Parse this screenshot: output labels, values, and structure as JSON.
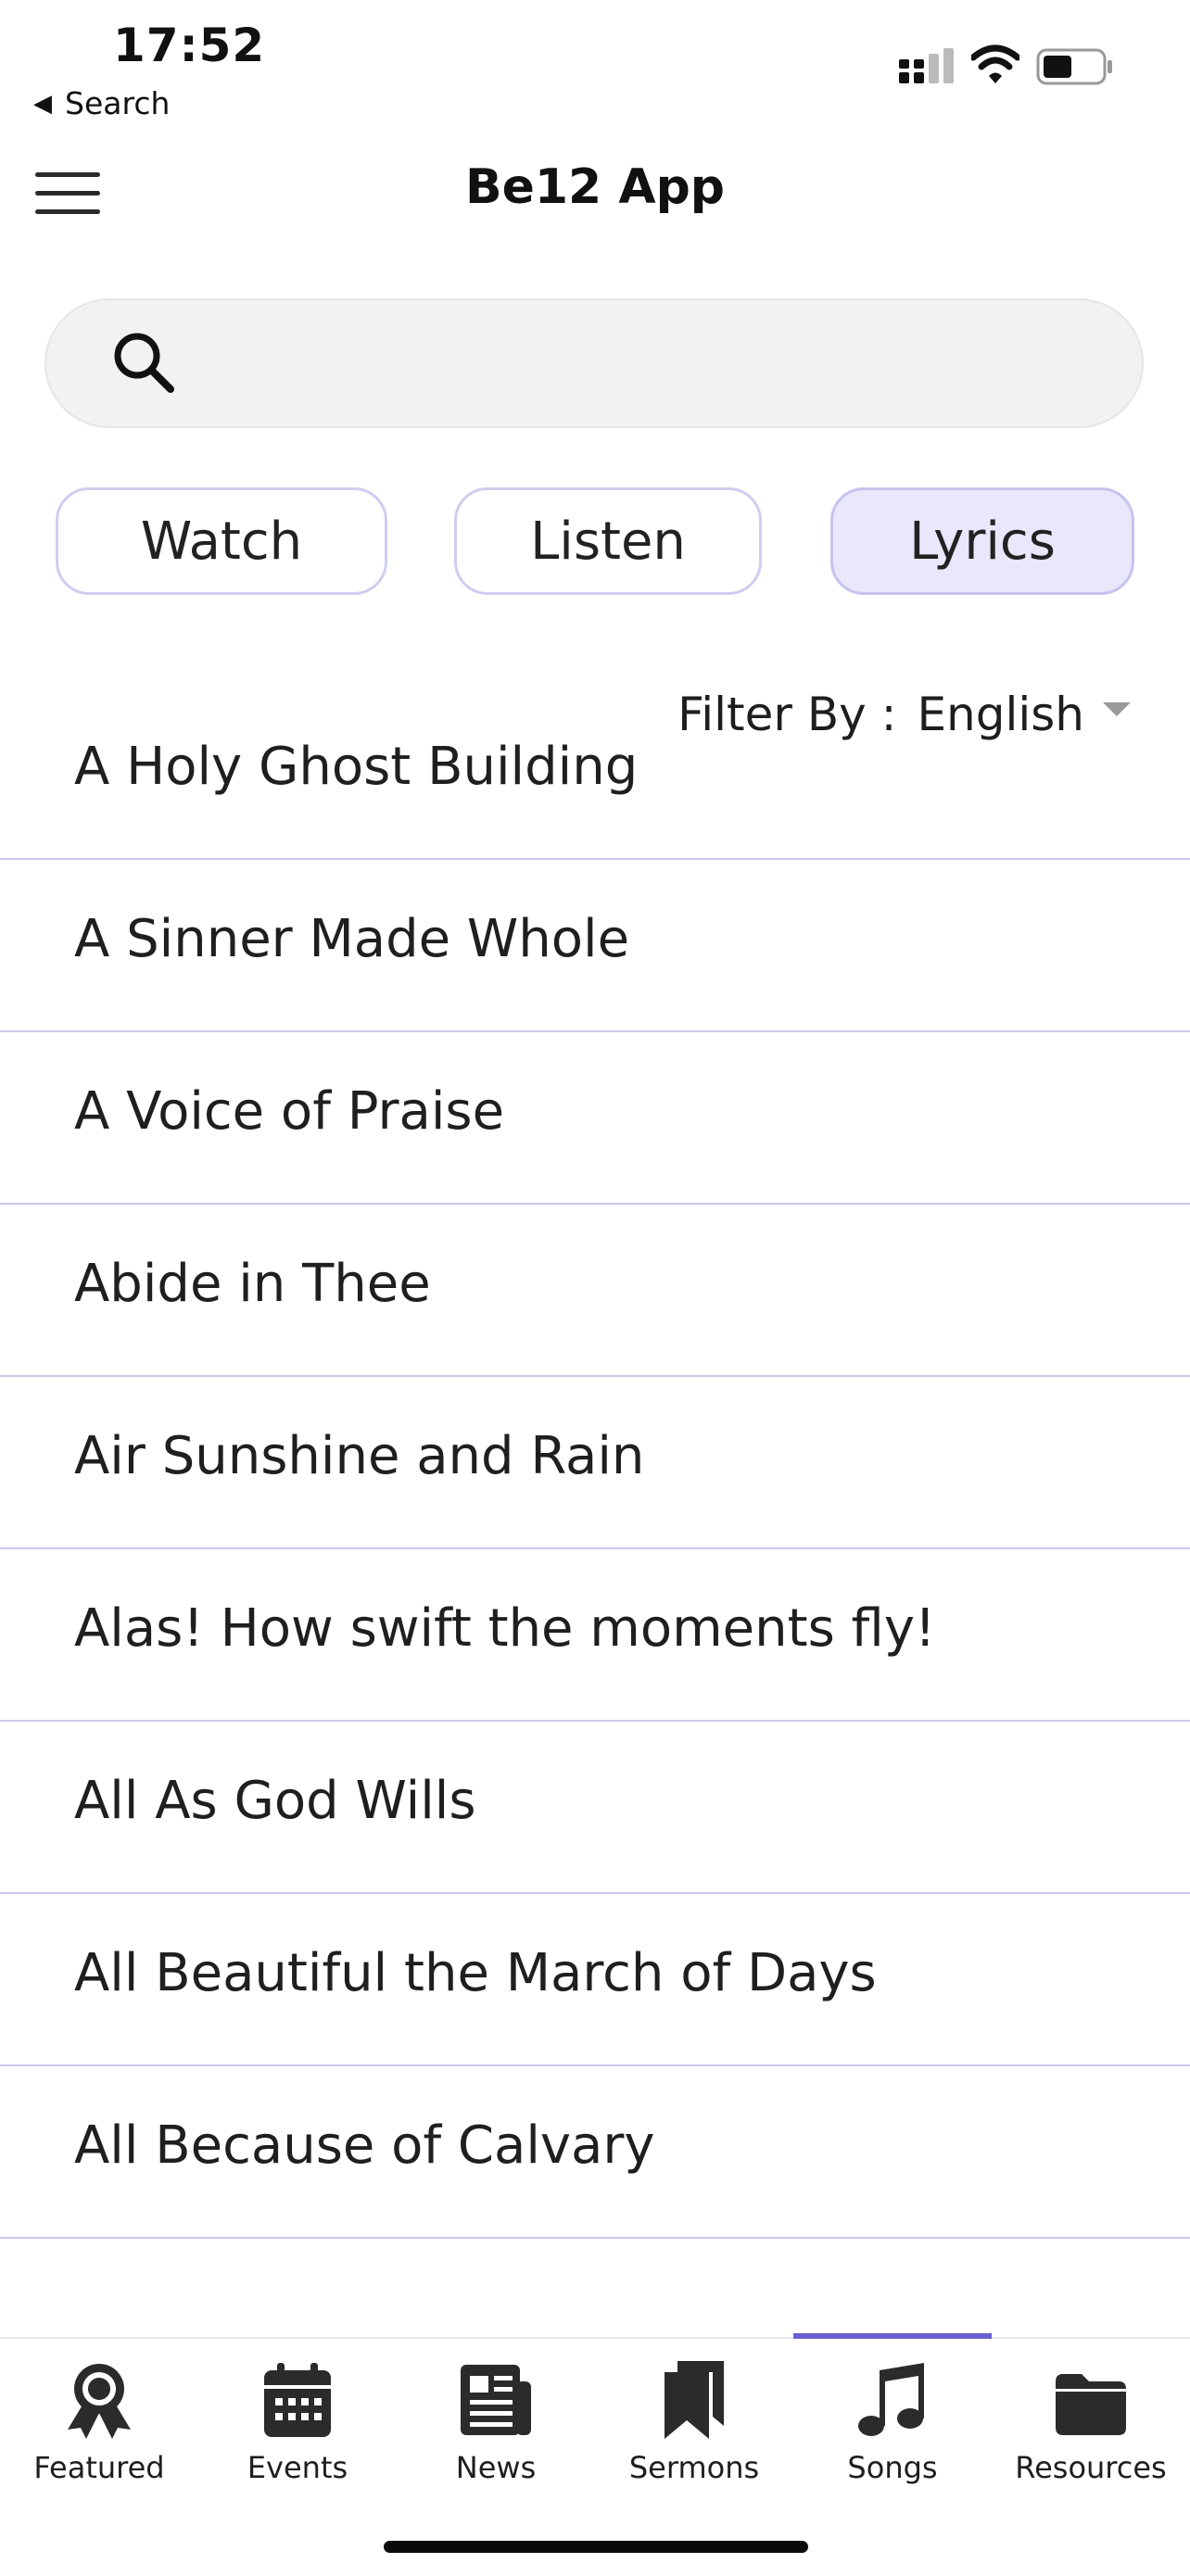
{
  "status_bar": {
    "time": "17:52",
    "back_label": "Search",
    "back_icon": "back-triangle-icon",
    "signal_icon": "cellular-signal-icon",
    "wifi_icon": "wifi-icon",
    "battery_icon": "battery-icon"
  },
  "header": {
    "title": "Be12 App",
    "menu_icon": "hamburger-menu-icon"
  },
  "search": {
    "value": "",
    "icon": "search-icon"
  },
  "tabs": [
    {
      "label": "Watch",
      "active": false
    },
    {
      "label": "Listen",
      "active": false
    },
    {
      "label": "Lyrics",
      "active": true
    }
  ],
  "filter": {
    "label": "Filter By :",
    "value": "English",
    "icon": "dropdown-caret-icon"
  },
  "songs": [
    "A Holy Ghost Building",
    "A Sinner Made Whole",
    "A Voice of Praise",
    "Abide in Thee",
    "Air Sunshine and Rain",
    "Alas! How swift the moments fly!",
    "All As God Wills",
    "All Beautiful the March of Days",
    "All Because of Calvary"
  ],
  "bottom_nav": [
    {
      "label": "Featured",
      "icon": "award-ribbon-icon",
      "active": false
    },
    {
      "label": "Events",
      "icon": "calendar-icon",
      "active": false
    },
    {
      "label": "News",
      "icon": "newspaper-icon",
      "active": false
    },
    {
      "label": "Sermons",
      "icon": "bookmarks-icon",
      "active": false
    },
    {
      "label": "Songs",
      "icon": "music-note-icon",
      "active": true
    },
    {
      "label": "Resources",
      "icon": "folder-icon",
      "active": false
    }
  ],
  "colors": {
    "accent": "#6a5fd0",
    "pill_border": "#cfcdf0",
    "pill_active_bg": "#e8e7fb",
    "divider": "#cbc9ee",
    "search_bg": "#f2f2f2"
  }
}
